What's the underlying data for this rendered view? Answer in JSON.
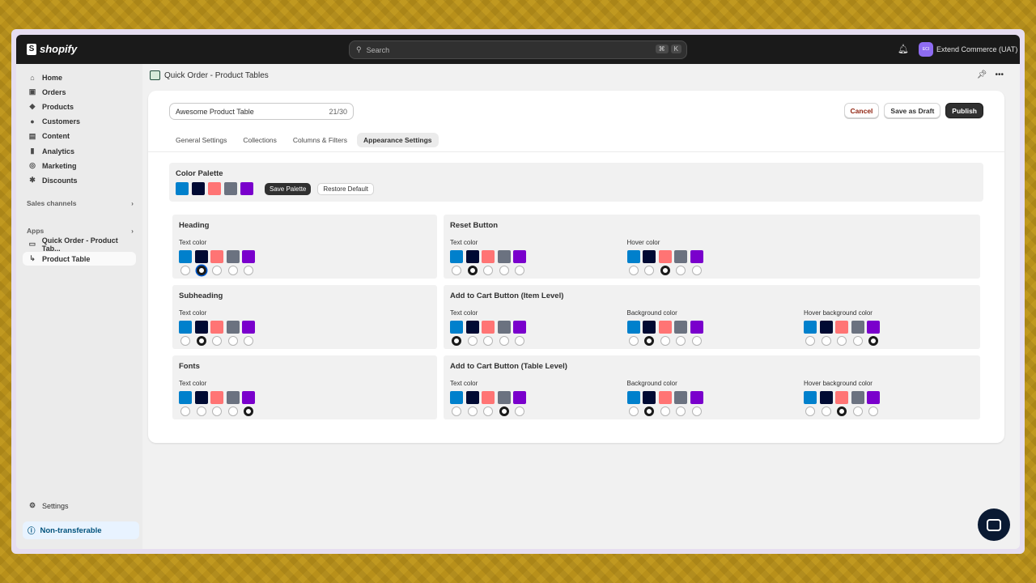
{
  "topbar": {
    "brand": "shopify",
    "search_placeholder": "Search",
    "shortcut": [
      "⌘",
      "K"
    ],
    "store_initials": "ECI",
    "store_name": "Extend Commerce (UAT)"
  },
  "sidebar": {
    "items": [
      {
        "label": "Home",
        "icon": "⌂"
      },
      {
        "label": "Orders",
        "icon": "▣"
      },
      {
        "label": "Products",
        "icon": "◆"
      },
      {
        "label": "Customers",
        "icon": "●"
      },
      {
        "label": "Content",
        "icon": "▤"
      },
      {
        "label": "Analytics",
        "icon": "▮"
      },
      {
        "label": "Marketing",
        "icon": "◎"
      },
      {
        "label": "Discounts",
        "icon": "✱"
      }
    ],
    "sales_channels": "Sales channels",
    "apps": "Apps",
    "app_item": "Quick Order - Product Tab...",
    "sub_item": "Product Table",
    "settings": "Settings",
    "non_transferable": "Non-transferable"
  },
  "app": {
    "title": "Quick Order - Product Tables"
  },
  "form": {
    "table_name": "Awesome Product Table",
    "char_count": "21/30",
    "cancel": "Cancel",
    "save_draft": "Save as Draft",
    "publish": "Publish"
  },
  "tabs": [
    {
      "label": "General Settings"
    },
    {
      "label": "Collections"
    },
    {
      "label": "Columns & Filters"
    },
    {
      "label": "Appearance Settings",
      "selected": true
    }
  ],
  "palette": {
    "title": "Color Palette",
    "colors": [
      "#0080cc",
      "#000a33",
      "#ff7474",
      "#6b7280",
      "#7a00cc"
    ],
    "save": "Save Palette",
    "restore": "Restore Default"
  },
  "panels": [
    {
      "title": "Heading",
      "groups": [
        {
          "label": "Text color",
          "selected": 1
        }
      ]
    },
    {
      "title": "Reset Button",
      "groups": [
        {
          "label": "Text color",
          "selected": 1
        },
        {
          "label": "Hover color",
          "selected": 2
        }
      ]
    },
    {
      "title": "Subheading",
      "groups": [
        {
          "label": "Text color",
          "selected": 1
        }
      ]
    },
    {
      "title": "Add to Cart Button (Item Level)",
      "groups": [
        {
          "label": "Text color",
          "selected": 0
        },
        {
          "label": "Background color",
          "selected": 1
        },
        {
          "label": "Hover background color",
          "selected": 4
        }
      ]
    },
    {
      "title": "Fonts",
      "groups": [
        {
          "label": "Text color",
          "selected": 4
        }
      ]
    },
    {
      "title": "Add to Cart Button (Table Level)",
      "groups": [
        {
          "label": "Text color",
          "selected": 3
        },
        {
          "label": "Background color",
          "selected": 1
        },
        {
          "label": "Hover background color",
          "selected": 2
        }
      ]
    }
  ]
}
